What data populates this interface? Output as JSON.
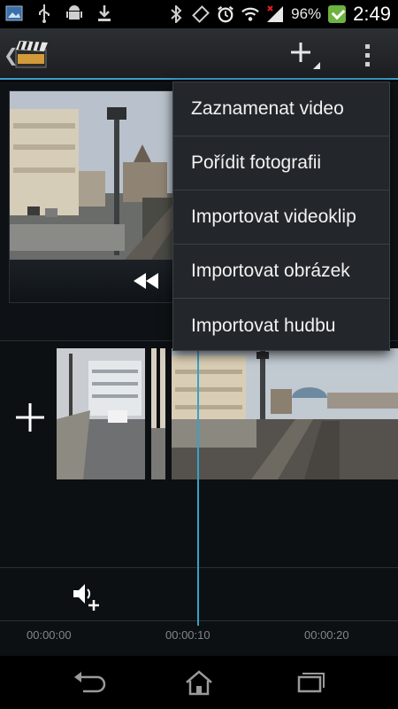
{
  "status_bar": {
    "battery_percent": "96%",
    "clock": "2:49",
    "icons": [
      "gallery-icon",
      "usb-icon",
      "android-debug-icon",
      "download-icon",
      "bluetooth-icon",
      "screen-rotation-icon",
      "alarm-icon",
      "wifi-icon",
      "signal-icon",
      "battery-charging-icon"
    ]
  },
  "action_bar": {
    "icons": [
      "back-chevron-icon",
      "movie-clapper-icon",
      "add-icon",
      "overflow-menu-icon"
    ]
  },
  "menu": {
    "items": [
      {
        "label": "Zaznamenat video"
      },
      {
        "label": "Pořídit fotografii"
      },
      {
        "label": "Importovat videoklip"
      },
      {
        "label": "Importovat obrázek"
      },
      {
        "label": "Importovat hudbu"
      }
    ]
  },
  "timeline": {
    "ruler_labels": [
      "00:00:00",
      "00:00:10",
      "00:00:20"
    ]
  },
  "colors": {
    "accent": "#3aa0c8",
    "background": "#0e1216",
    "menu_background": "#23272b"
  }
}
